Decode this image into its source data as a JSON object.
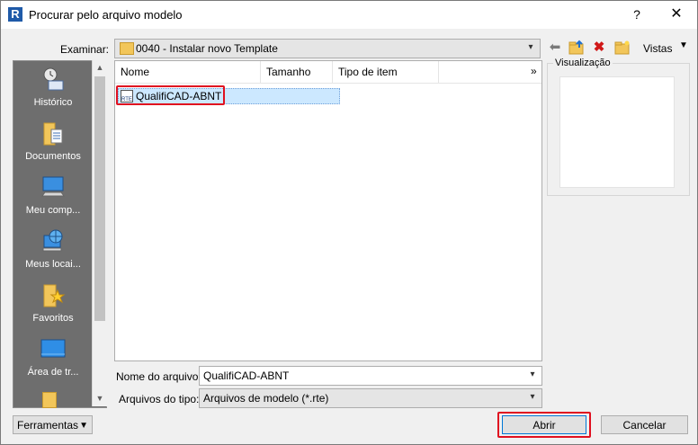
{
  "window": {
    "title": "Procurar pelo arquivo modelo",
    "app_icon_letter": "R",
    "help": "?",
    "close": "✕"
  },
  "lookin": {
    "label": "Examinar:",
    "value": "0040 - Instalar novo Template",
    "views_label": "Vistas"
  },
  "places": [
    {
      "name": "Histórico",
      "icon": "history-icon"
    },
    {
      "name": "Documentos",
      "icon": "documents-folder-icon"
    },
    {
      "name": "Meu comp...",
      "icon": "computer-icon"
    },
    {
      "name": "Meus locai...",
      "icon": "network-globe-icon"
    },
    {
      "name": "Favoritos",
      "icon": "favorites-folder-icon"
    },
    {
      "name": "Área de tr...",
      "icon": "desktop-icon"
    }
  ],
  "filelist": {
    "columns": [
      "Nome",
      "Tamanho",
      "Tipo de item"
    ],
    "more": "»",
    "files": [
      {
        "name": "QualifiCAD-ABNT",
        "icon_text": "RTE"
      }
    ]
  },
  "preview": {
    "label": "Visualização"
  },
  "filename": {
    "label": "Nome do arquivo:",
    "value": "QualifiCAD-ABNT"
  },
  "filetype": {
    "label": "Arquivos do tipo:",
    "value": "Arquivos de modelo  (*.rte)"
  },
  "buttons": {
    "tools": "Ferramentas",
    "open": "Abrir",
    "cancel": "Cancelar"
  },
  "colors": {
    "highlight_red": "#e01020",
    "places_bg": "#6e6e6e",
    "selection": "#cce8ff"
  }
}
